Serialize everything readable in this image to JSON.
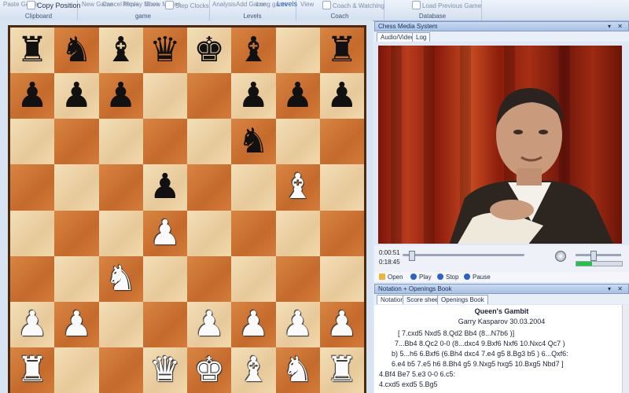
{
  "ribbon": {
    "paste_label": "Paste Game",
    "copy_label": "Copy Position",
    "clipboard_label": "Clipboard",
    "new_game_label": "New Game",
    "cancel_move_label": "Cancel Move",
    "replay_label": "Replay Move",
    "show_moves_label": "Show Moves",
    "step_clocks_label": "Step Clocks",
    "game_label": "game",
    "analysis_label": "Analysis",
    "add_game_label": "Add Game",
    "long_game_label": "Long game",
    "levels_btn_label": "Levels",
    "levels_label": "Levels",
    "view_label": "View",
    "coach_watching_label": "Coach & Watching",
    "coach_label": "Coach",
    "load_prev_label": "Load Previous Game",
    "database_label": "Database"
  },
  "media": {
    "title": "Chess Media System",
    "tab_video": "Audio/Video",
    "tab_log": "Log",
    "time_elapsed": "0:00:51",
    "time_total": "0:18:45",
    "progress": 0.05,
    "volume": 0.35,
    "open_label": "Open",
    "play_label": "Play",
    "stop_label": "Stop",
    "pause_label": "Pause"
  },
  "notation_panel": {
    "title": "Notation + Openings Book",
    "tabs": [
      "Notation",
      "Score sheet",
      "Openings Book"
    ],
    "game_title": "Queen's Gambit",
    "game_sub": "Garry Kasparov 30.03.2004",
    "lines": [
      "[ 7.cxd5  Nxd5  8.Qd2  Bb4  (8...N7b6 )]",
      "7...Bb4  8.Qc2  0-0  (8...dxc4  9.Bxf6  Nxf6  10.Nxc4  Qc7 )",
      "b) 5...h6  6.Bxf6  (6.Bh4  dxc4  7.e4  g5  8.Bg3  b5 )  6...Qxf6:",
      "6.e4  b5  7.e5  h6  8.Bh4  g5  9.Nxg5  hxg5  10.Bxg5  Nbd7 ]",
      "4.Bf4  Be7  5.e3  0-0  6.c5:",
      "4.cxd5  exd5  5.Bg5"
    ]
  },
  "colors": {
    "light_square": "#ecd2a6",
    "dark_square": "#cf7636",
    "board_border": "#4b2a12",
    "accent": "#2a63c8"
  },
  "board": [
    [
      "br",
      "bn",
      "bb",
      "bq",
      "bk",
      "bb",
      "",
      "br"
    ],
    [
      "bp",
      "bp",
      "bp",
      "",
      "",
      "bp",
      "bp",
      "bp"
    ],
    [
      "",
      "",
      "",
      "",
      "",
      "bn",
      "",
      ""
    ],
    [
      "",
      "",
      "",
      "bp",
      "",
      "",
      "wb",
      ""
    ],
    [
      "",
      "",
      "",
      "wp",
      "",
      "",
      "",
      ""
    ],
    [
      "",
      "",
      "wn",
      "",
      "",
      "",
      "",
      ""
    ],
    [
      "wp",
      "wp",
      "",
      "",
      "wp",
      "wp",
      "wp",
      "wp"
    ],
    [
      "wr",
      "",
      "",
      "wq",
      "wk",
      "wb",
      "wn",
      "wr"
    ]
  ],
  "pieces": {
    "br": "♜",
    "bn": "♞",
    "bb": "♝",
    "bq": "♛",
    "bk": "♚",
    "bp": "♟",
    "wr": "♜",
    "wn": "♞",
    "wb": "♝",
    "wq": "♛",
    "wk": "♚",
    "wp": "♟"
  }
}
